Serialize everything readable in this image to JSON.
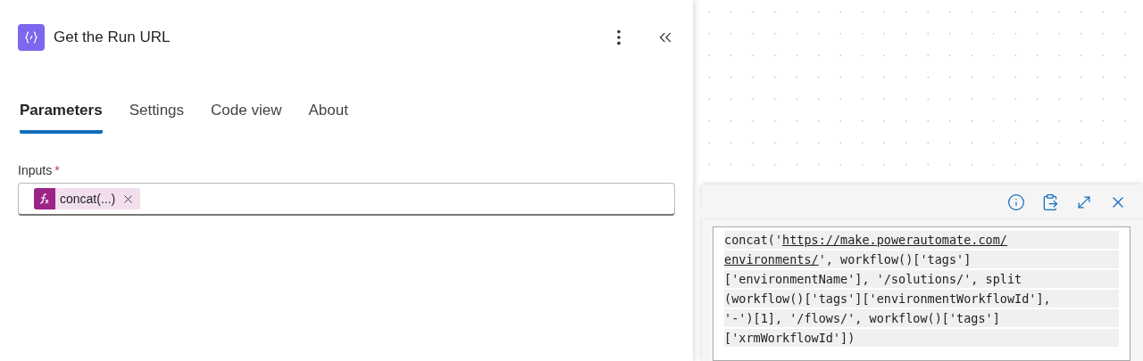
{
  "panel": {
    "title": "Get the Run URL"
  },
  "tabs": [
    {
      "label": "Parameters",
      "selected": true
    },
    {
      "label": "Settings",
      "selected": false
    },
    {
      "label": "Code view",
      "selected": false
    },
    {
      "label": "About",
      "selected": false
    }
  ],
  "inputs": {
    "label": "Inputs",
    "required_mark": "*",
    "token": {
      "text": "concat(...)"
    }
  },
  "expression_editor": {
    "lines": [
      [
        {
          "text": "concat('",
          "link": false
        },
        {
          "text": "https://make.powerautomate.com/",
          "link": true
        }
      ],
      [
        {
          "text": "environments/",
          "link": true
        },
        {
          "text": "', workflow()['tags']",
          "link": false
        }
      ],
      [
        {
          "text": "['environmentName'], '/solutions/', split",
          "link": false
        }
      ],
      [
        {
          "text": "(workflow()['tags']['environmentWorkflowId'],",
          "link": false
        }
      ],
      [
        {
          "text": "'-')[1], '/flows/', workflow()['tags']",
          "link": false
        }
      ],
      [
        {
          "text": "['xrmWorkflowId'])",
          "link": false
        }
      ]
    ]
  }
}
